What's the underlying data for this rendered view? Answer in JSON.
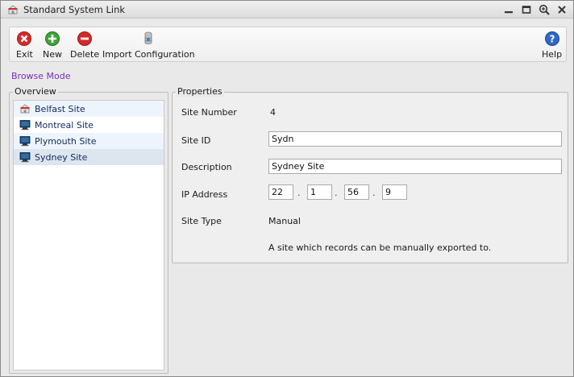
{
  "window": {
    "title": "Standard System Link"
  },
  "toolbar": {
    "exit_label": "Exit",
    "new_label": "New",
    "delete_label": "Delete",
    "import_label": "Import Configuration",
    "help_label": "Help"
  },
  "mode": {
    "label": "Browse Mode"
  },
  "overview": {
    "title": "Overview",
    "items": [
      {
        "label": "Belfast Site",
        "icon": "home-site-icon"
      },
      {
        "label": "Montreal Site",
        "icon": "monitor-icon"
      },
      {
        "label": "Plymouth Site",
        "icon": "monitor-icon"
      },
      {
        "label": "Sydney Site",
        "icon": "monitor-icon",
        "selected": true
      }
    ]
  },
  "properties": {
    "title": "Properties",
    "site_number_label": "Site Number",
    "site_number_value": "4",
    "site_id_label": "Site ID",
    "site_id_value": "Sydn",
    "description_label": "Description",
    "description_value": "Sydney Site",
    "ip_label": "IP Address",
    "ip_octets": [
      "22",
      "1",
      "56",
      "9"
    ],
    "site_type_label": "Site Type",
    "site_type_value": "Manual",
    "site_type_note": "A site which records can be manually exported to."
  },
  "colors": {
    "accent_link": "#7a2fb8",
    "exit_red": "#d42a2a",
    "new_green": "#3ea33a",
    "help_blue": "#2f67c4"
  }
}
